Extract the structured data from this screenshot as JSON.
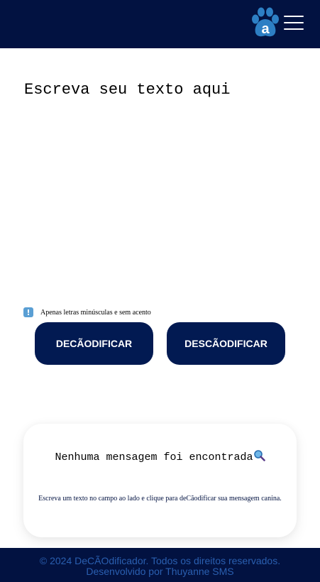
{
  "header": {
    "logo_icon": "paw-letter-a-logo",
    "menu_icon": "hamburger-menu-icon",
    "background": "#021241"
  },
  "editor": {
    "placeholder": "Escreva seu texto aqui"
  },
  "hint": {
    "icon": "exclamation-info-icon",
    "text": "Apenas letras minúsculas e sem acento"
  },
  "actions": {
    "encode_label": "DECÃODIFICAR",
    "decode_label": "DESCÃODIFICAR",
    "button_color": "#021a52"
  },
  "result": {
    "title": "Nenhuma mensagem foi encontrada",
    "title_icon": "magnifier-icon",
    "description": "Escreva um texto no campo ao lado e clique para deCãodificar sua mensagem canina."
  },
  "footer": {
    "line1": "© 2024 DeCÃOdificador. Todos os direitos reservados.",
    "line2": "Desenvolvido por Thuyanne SMS"
  }
}
